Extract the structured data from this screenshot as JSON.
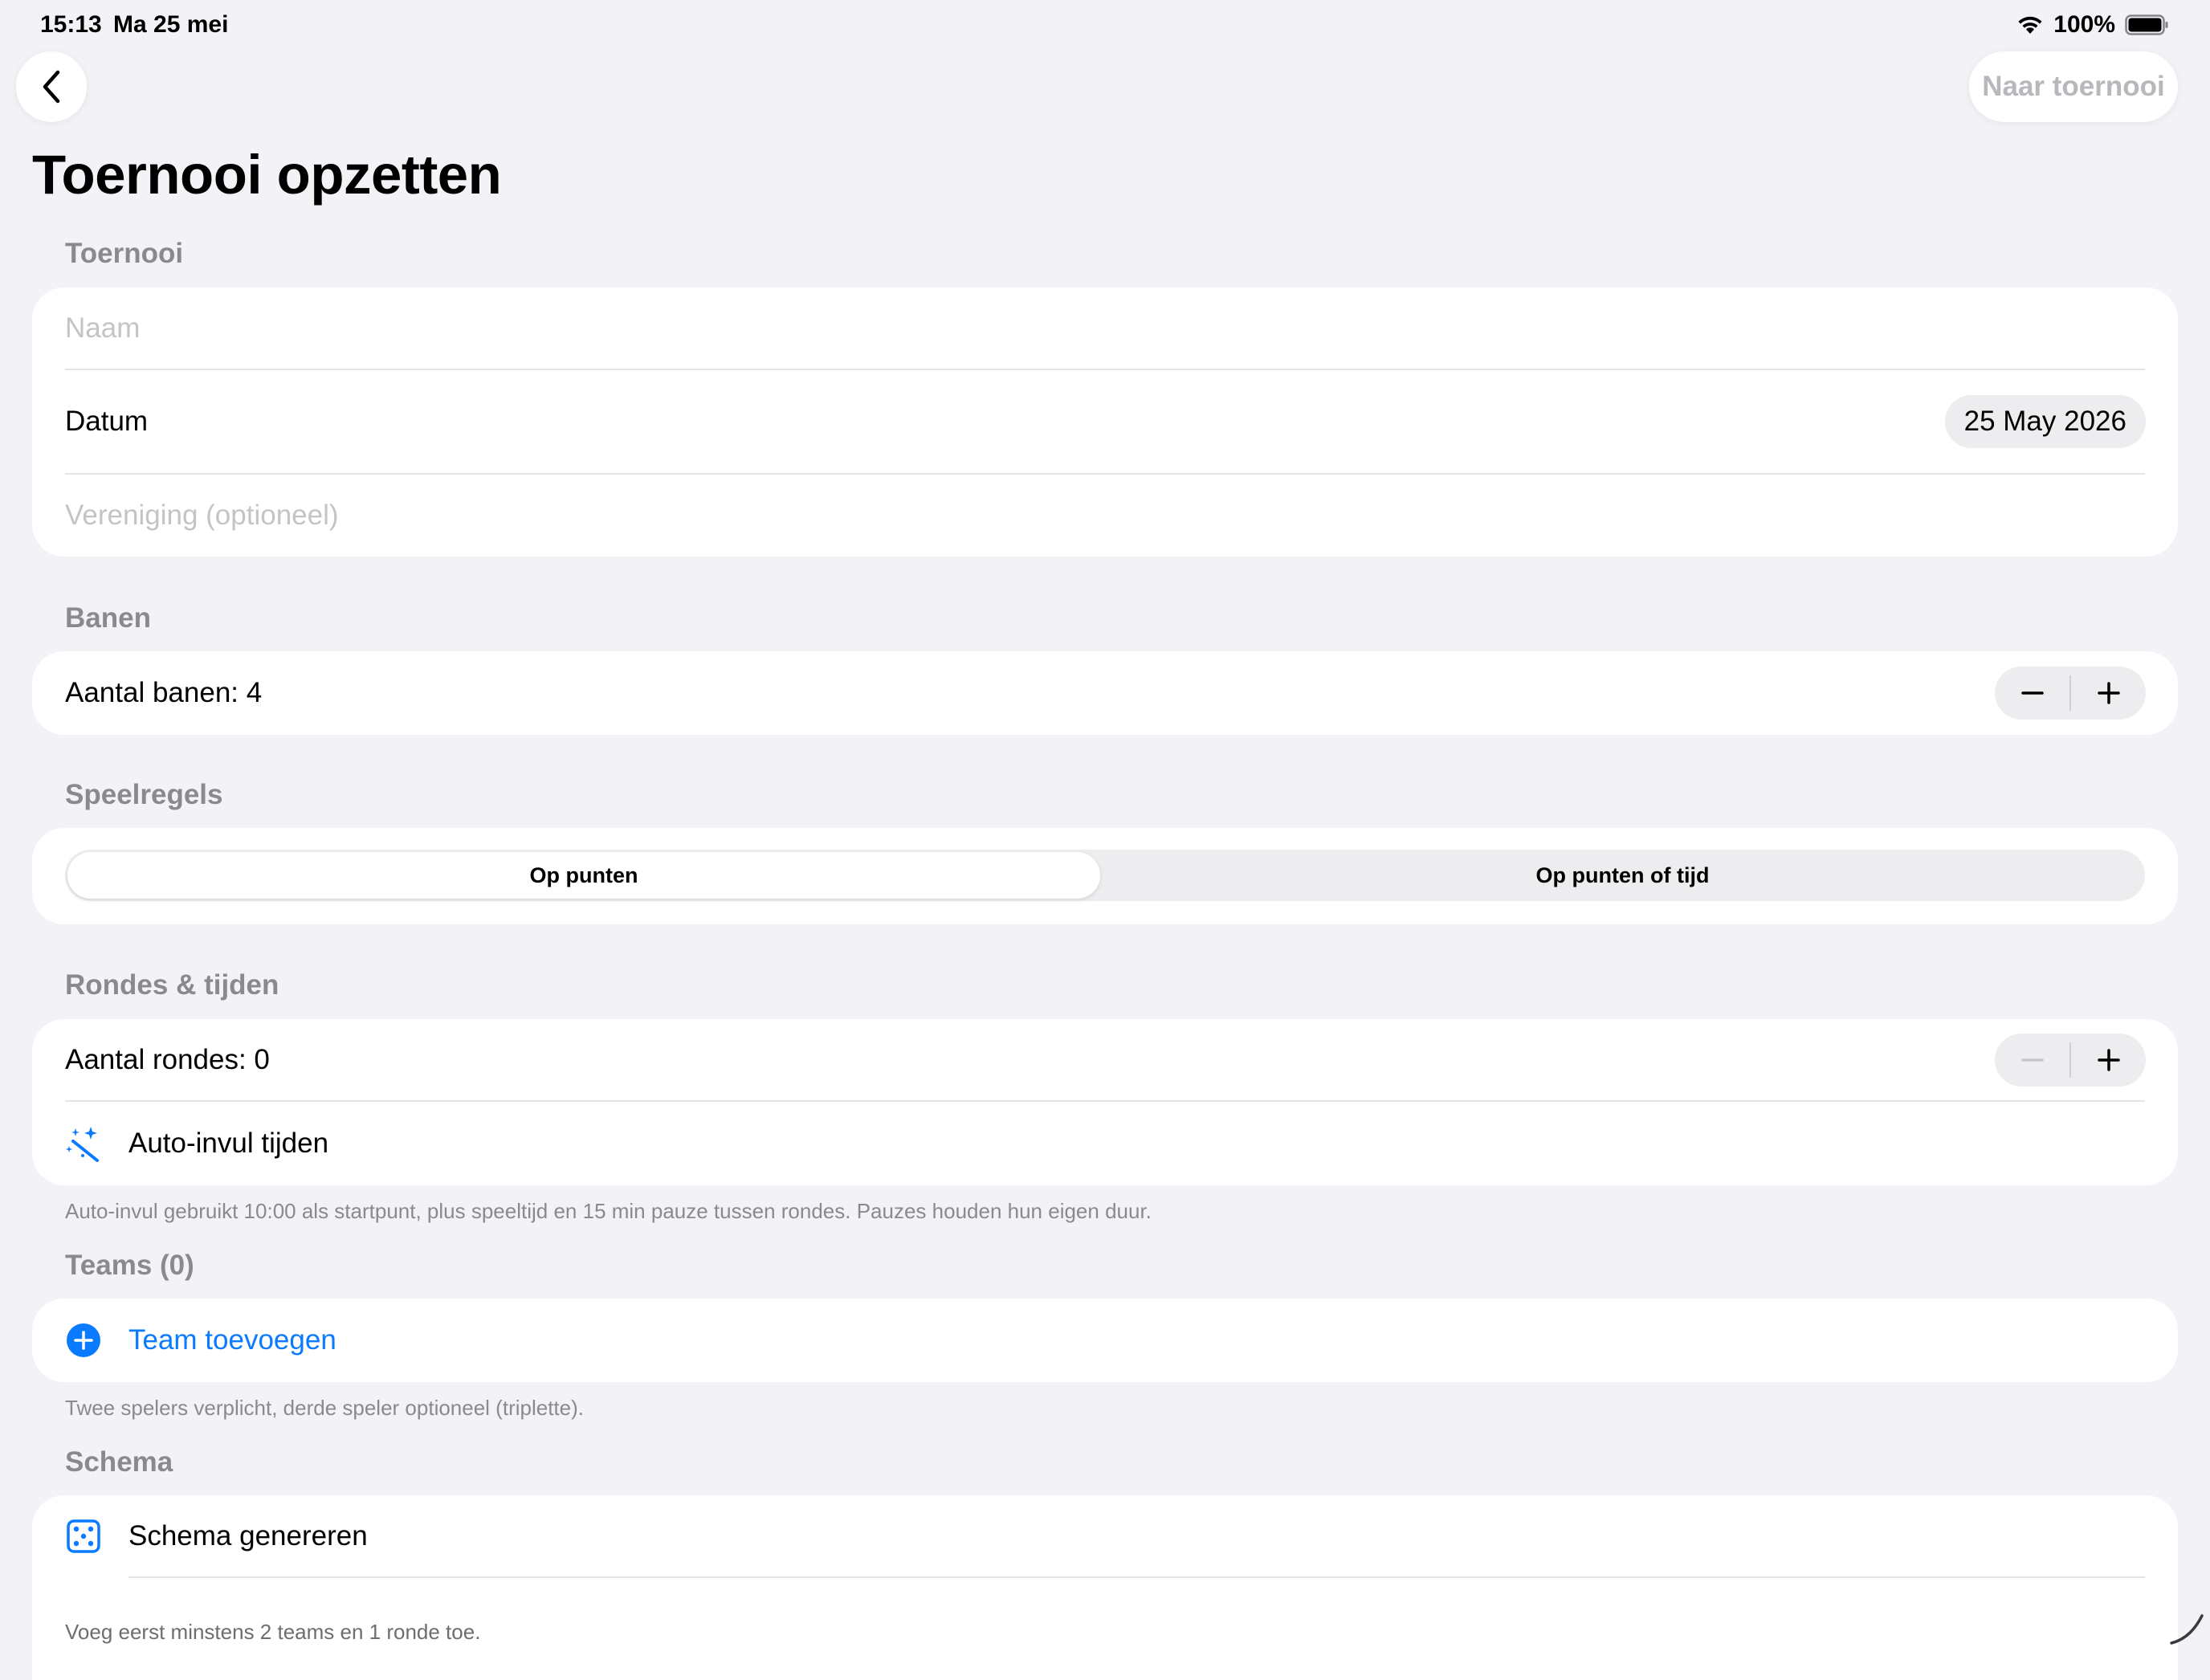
{
  "status_bar": {
    "time": "15:13",
    "date": "Ma 25 mei",
    "battery": "100%",
    "wifi_icon": "wifi-icon",
    "battery_icon": "battery-icon"
  },
  "nav": {
    "back_icon": "chevron-left-icon",
    "right_button_label": "Naar toernooi"
  },
  "page_title": "Toernooi opzetten",
  "sections": {
    "toernooi": {
      "header": "Toernooi",
      "name_placeholder": "Naam",
      "date_label": "Datum",
      "date_value": "25 May 2026",
      "club_placeholder": "Vereniging (optioneel)"
    },
    "banen": {
      "header": "Banen",
      "count_label": "Aantal banen: 4"
    },
    "speelregels": {
      "header": "Speelregels",
      "options": [
        "Op punten",
        "Op punten of tijd"
      ],
      "selected": "Op punten"
    },
    "rondes": {
      "header": "Rondes & tijden",
      "count_label": "Aantal rondes: 0",
      "autofill_label": "Auto-invul tijden",
      "autofill_icon": "magic-wand-icon",
      "footnote": "Auto-invul gebruikt 10:00 als startpunt, plus speeltijd en 15 min pauze tussen rondes. Pauzes houden hun eigen duur."
    },
    "teams": {
      "header": "Teams (0)",
      "add_label": "Team toevoegen",
      "add_icon": "plus-circle-icon",
      "footnote": "Twee spelers verplicht, derde speler optioneel (triplette)."
    },
    "schema": {
      "header": "Schema",
      "generate_label": "Schema genereren",
      "generate_icon": "dice-icon",
      "note": "Voeg eerst minstens 2 teams en 1 ronde toe."
    }
  },
  "colors": {
    "background": "#f2f2f7",
    "card": "#ffffff",
    "accent": "#0a7aff",
    "secondary_text": "#8a8a8e",
    "placeholder": "#c4c4c7"
  }
}
